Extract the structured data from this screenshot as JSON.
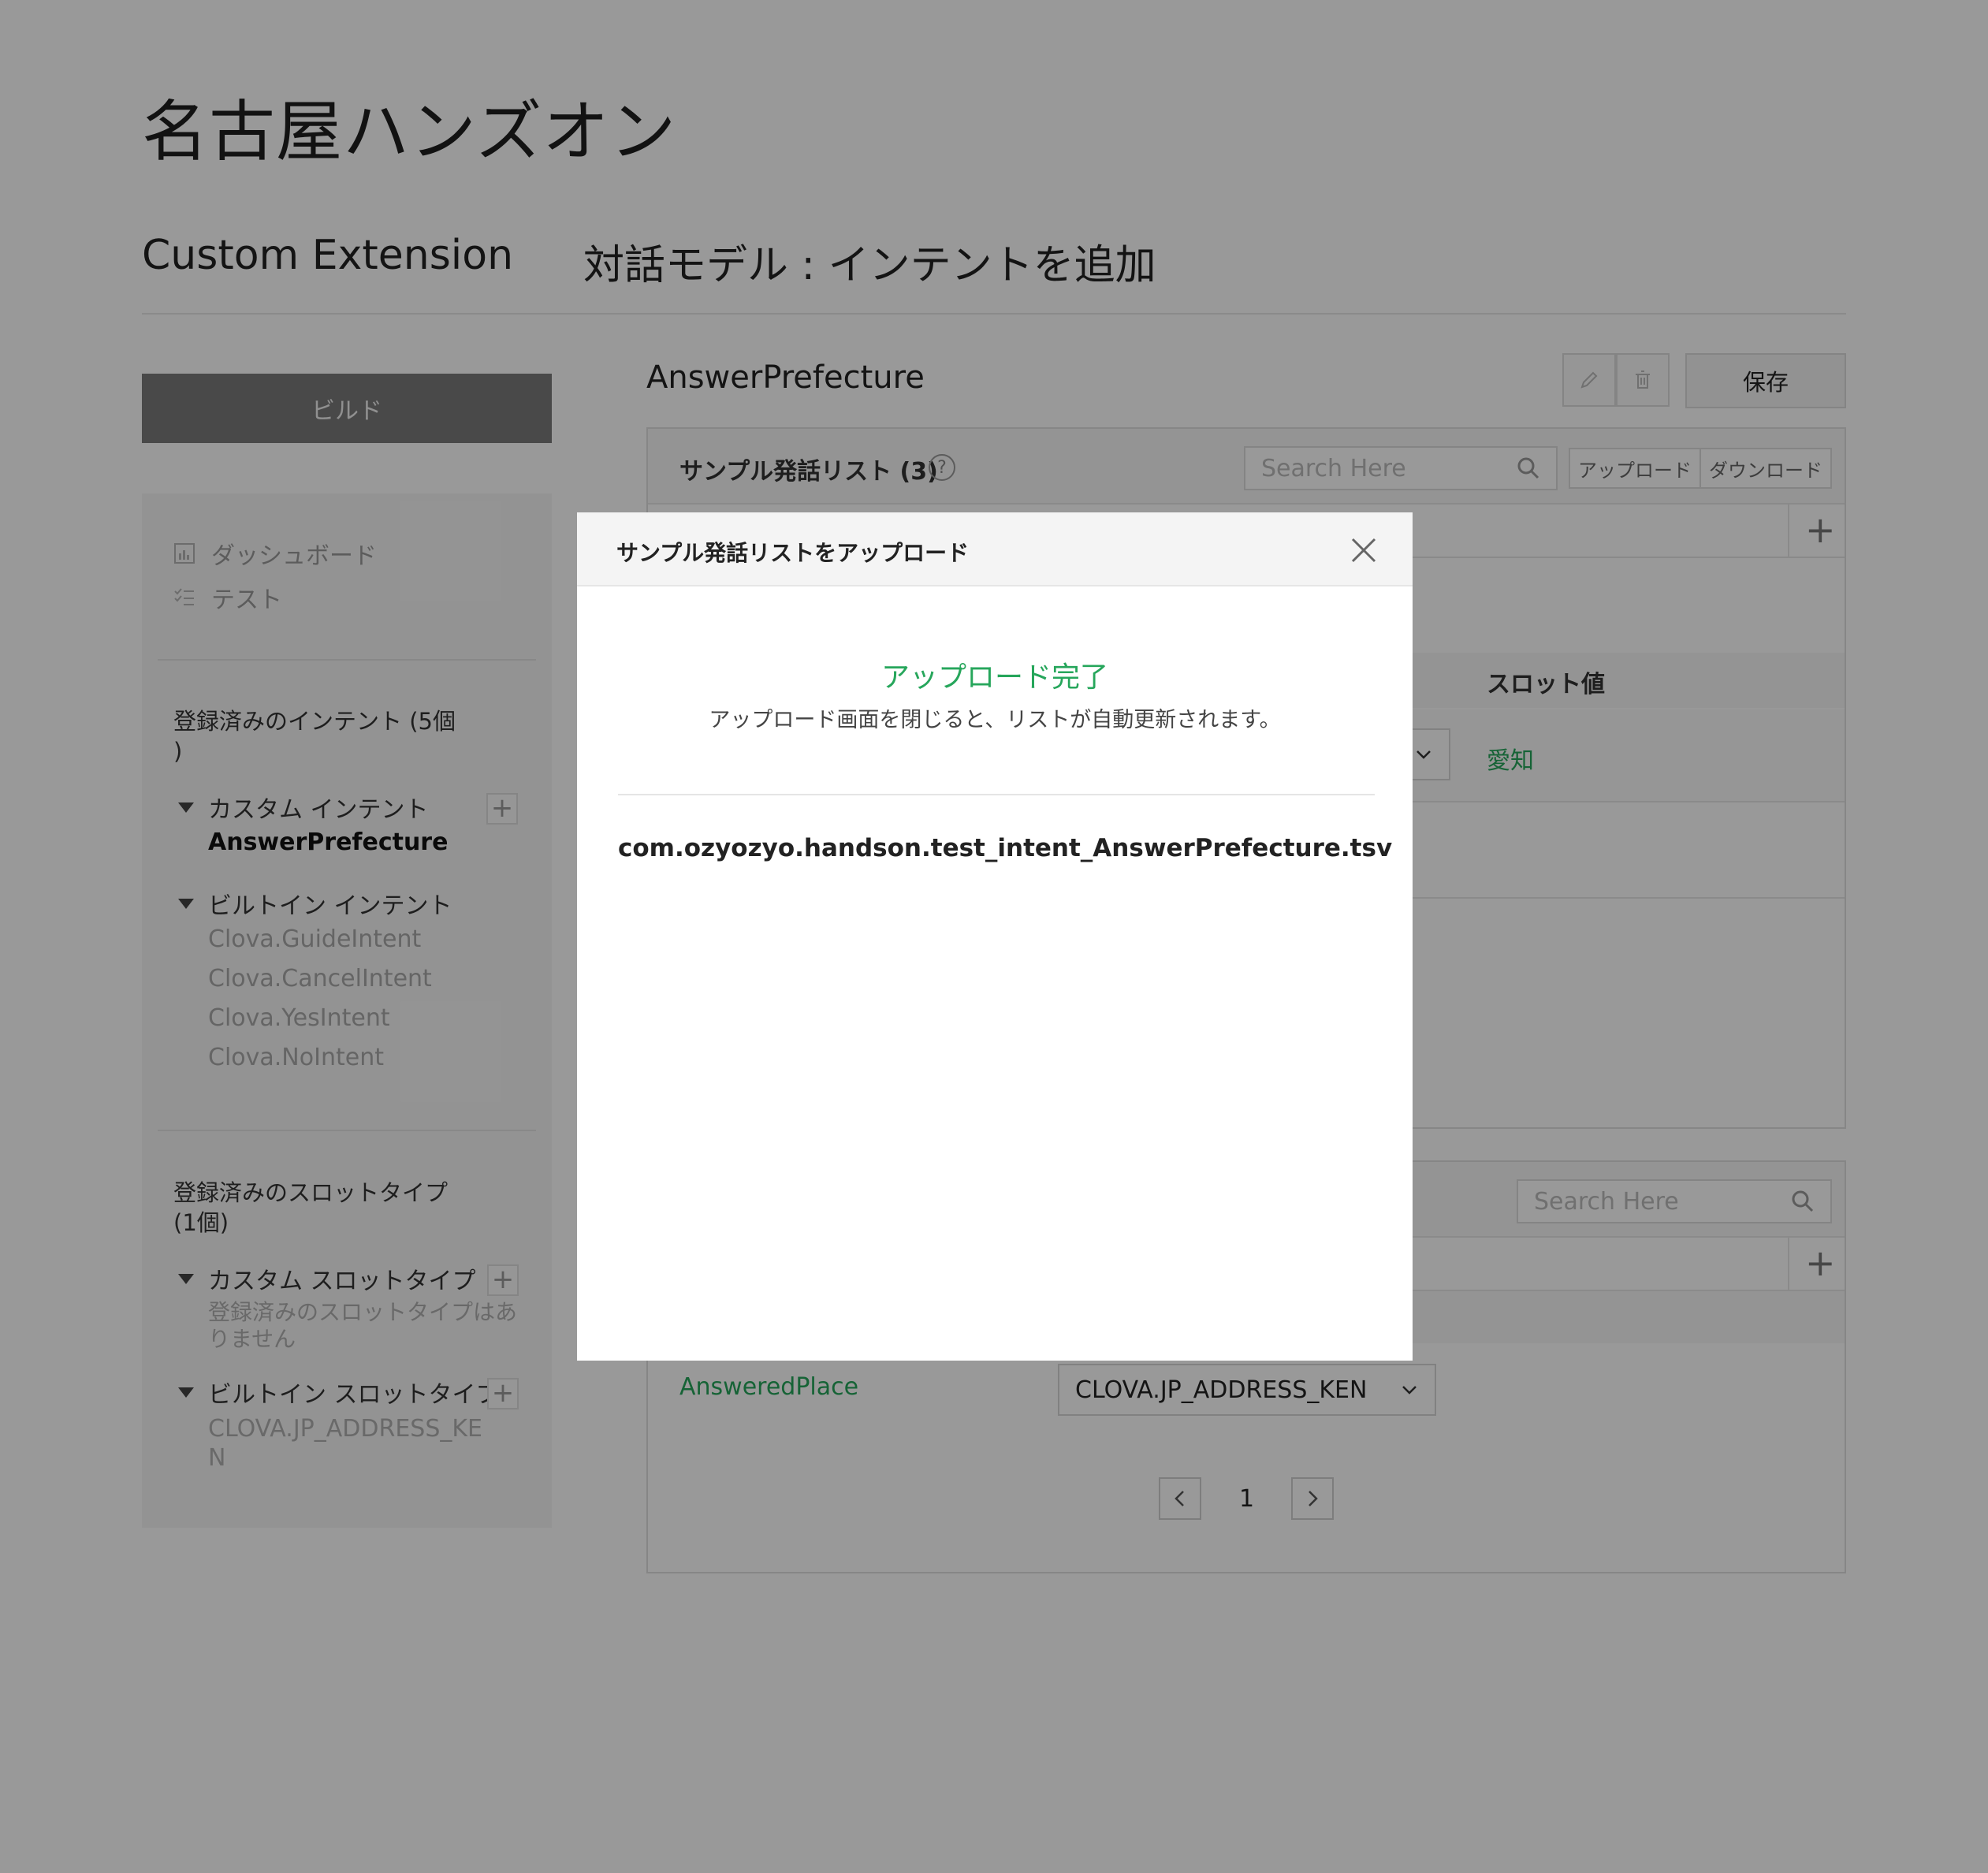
{
  "header": {
    "app_title": "名古屋ハンズオン",
    "section_title": "Custom Extension",
    "page_subtitle": "対話モデル : インテントを追加"
  },
  "sidebar": {
    "build_label": "ビルド",
    "nav": [
      {
        "label": "ダッシュボード",
        "icon": "chart-icon"
      },
      {
        "label": "テスト",
        "icon": "checklist-icon"
      }
    ],
    "intents_heading_line1": "登録済みのインテント (5個",
    "intents_heading_line2": ")",
    "custom_intent_label": "カスタム インテント",
    "custom_intents": [
      "AnswerPrefecture"
    ],
    "builtin_intent_label": "ビルトイン インテント",
    "builtin_intents": [
      "Clova.GuideIntent",
      "Clova.CancelIntent",
      "Clova.YesIntent",
      "Clova.NoIntent"
    ],
    "slot_types_heading_line1": "登録済みのスロットタイプ",
    "slot_types_heading_line2": "(1個)",
    "custom_slot_label": "カスタム スロットタイプ",
    "custom_slot_empty_line1": "登録済みのスロットタイプはあ",
    "custom_slot_empty_line2": "りません",
    "builtin_slot_label": "ビルトイン スロットタイプ",
    "builtin_slot_line1": "CLOVA.JP_ADDRESS_KE",
    "builtin_slot_line2": "N"
  },
  "main": {
    "intent_name": "AnswerPrefecture",
    "save_label": "保存",
    "utterances": {
      "title": "サンプル発話リスト (3)",
      "help": "?",
      "search_placeholder": "Search Here",
      "upload_label": "アップロード",
      "download_label": "ダウンロード",
      "add": "+"
    },
    "slot_table": {
      "col_value": "スロット値",
      "row_value": "愛知"
    },
    "slots": {
      "search_placeholder": "Search Here",
      "add": "+",
      "row_name": "AnsweredPlace",
      "row_type": "CLOVA.JP_ADDRESS_KEN"
    },
    "pagination": {
      "current": "1"
    }
  },
  "modal": {
    "title": "サンプル発話リストをアップロード",
    "success": "アップロード完了",
    "description": "アップロード画面を閉じると、リストが自動更新されます。",
    "filename": "com.ozyozyo.handson.test_intent_AnswerPrefecture.tsv"
  },
  "colors": {
    "accent_green": "#26a65b",
    "overlay": "rgba(0,0,0,0.4)"
  }
}
